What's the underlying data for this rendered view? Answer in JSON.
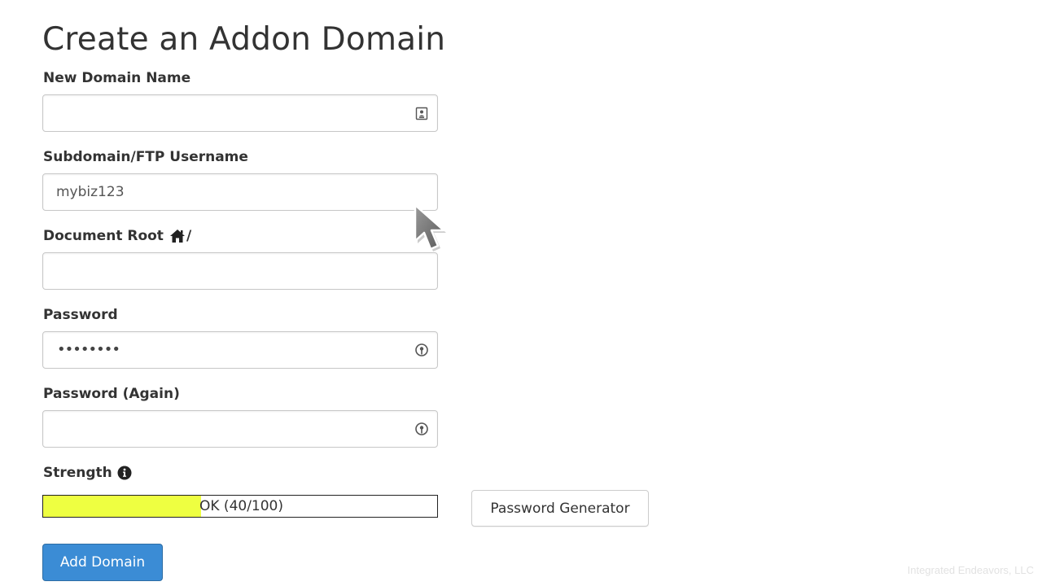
{
  "page": {
    "title": "Create an Addon Domain"
  },
  "form": {
    "new_domain": {
      "label": "New Domain Name",
      "value": "",
      "icon": "contact-card-icon"
    },
    "subdomain": {
      "label": "Subdomain/FTP Username",
      "value": "mybiz123"
    },
    "document_root": {
      "label": "Document Root",
      "suffix": "/",
      "icon": "home-icon",
      "value": ""
    },
    "password": {
      "label": "Password",
      "masked_value": "••••••••",
      "icon": "key-icon"
    },
    "password_again": {
      "label": "Password (Again)",
      "value": "",
      "icon": "key-icon"
    },
    "strength": {
      "label": "Strength",
      "info_icon": "info-circle-icon",
      "text": "OK (40/100)",
      "score": 40,
      "max": 100,
      "bar_color": "#eeff41"
    },
    "password_generator_label": "Password Generator",
    "submit_label": "Add Domain"
  },
  "colors": {
    "primary_button": "#3b8cd5",
    "text": "#333333"
  },
  "watermark": "Integrated Endeavors, LLC"
}
